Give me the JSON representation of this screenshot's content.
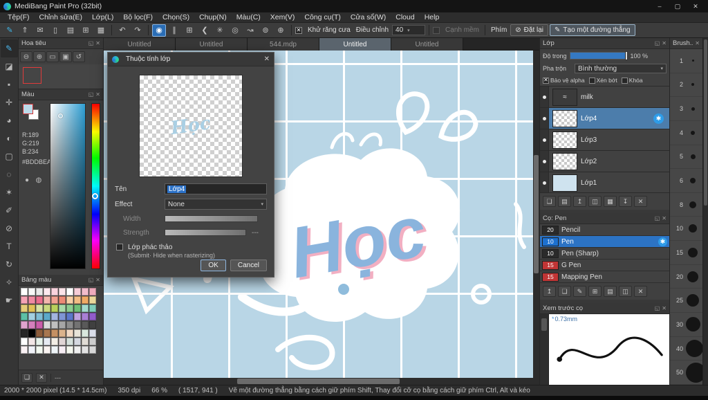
{
  "window": {
    "title": "MediBang Paint Pro (32bit)"
  },
  "icons": {
    "minimize": "–",
    "maximize": "▢",
    "close": "✕",
    "float": "◱",
    "check": "✕",
    "undo": "↶",
    "redo": "↷",
    "dropdown": "▾",
    "reset": "⊘",
    "pen": "✎",
    "star": "*"
  },
  "menu": {
    "items": [
      "Tệp(F)",
      "Chỉnh sửa(E)",
      "Lớp(L)",
      "Bộ lọc(F)",
      "Chọn(S)",
      "Chụp(N)",
      "Màu(C)",
      "Xem(V)",
      "Công cụ(T)",
      "Cửa sổ(W)",
      "Cloud",
      "Help"
    ]
  },
  "toolbar": {
    "file_icons": [
      "✎",
      "⇑",
      "✉",
      "▯",
      "▤",
      "⊞",
      "▦"
    ],
    "option_buttons": [
      {
        "glyph": "◉",
        "selected": true
      },
      {
        "glyph": "∥"
      },
      {
        "glyph": "⊞"
      },
      {
        "glyph": "❮"
      },
      {
        "glyph": "✳"
      },
      {
        "glyph": "◎"
      },
      {
        "glyph": "↝"
      },
      {
        "glyph": "⊚"
      },
      {
        "glyph": "⊕"
      }
    ],
    "antialias_label": "Khử răng cưa",
    "adjust_label": "Điều chỉnh",
    "adjust_value": "40",
    "soft_edge_label": "Cạnh mềm",
    "key_label": "Phím",
    "reset_label": "Đặt lại",
    "line_label": "Tạo một đường thẳng"
  },
  "toolstrip": {
    "tools": [
      "✎",
      "◪",
      "▪",
      "✛",
      "◕",
      "◐",
      "▢",
      "◌",
      "✶",
      "✐",
      "⊘",
      "T",
      "↻",
      "✧",
      "☛"
    ]
  },
  "navigator": {
    "title": "Hoa tiêu",
    "buttons": [
      "⊖",
      "⊕",
      "▭",
      "▣",
      "↺"
    ]
  },
  "color_panel": {
    "title": "Màu",
    "r": "R:189",
    "g": "G:219",
    "b": "B:234",
    "hex": "#BDDBEA",
    "fg_color": "#BDDBEA",
    "circle_icons": [
      "●",
      "◍"
    ]
  },
  "palette_panel": {
    "title": "Bảng màu",
    "footer_value": "---",
    "footer_icons": [
      "❏",
      "✕"
    ],
    "colors": [
      "#ffffff",
      "#f7f7f7",
      "#e8e8e8",
      "#fce8ee",
      "#f9d3de",
      "#fbe3e8",
      "#ffffff",
      "#f6cdd8",
      "#f1bccb",
      "#eeaabc",
      "#f5a3b5",
      "#ef8aa2",
      "#e96f8e",
      "#f3b6ae",
      "#f0a091",
      "#ec8a76",
      "#f7cfa6",
      "#f3bc85",
      "#efa964",
      "#ead79a",
      "#e5cc78",
      "#e0c157",
      "#d9e3a3",
      "#c9d97f",
      "#b9cf5c",
      "#a8d9a8",
      "#8ccc8f",
      "#70bf77",
      "#a3d9cc",
      "#7fccb9",
      "#5cbfa6",
      "#a3cfe0",
      "#7fbcd4",
      "#5ca9c9",
      "#a3b4e0",
      "#7f95d4",
      "#5c77c9",
      "#bfa3e0",
      "#a87fd4",
      "#915cc9",
      "#e0a3cf",
      "#d47fbc",
      "#c95ca9",
      "#d9d9d9",
      "#bfbfbf",
      "#a6a6a6",
      "#8c8c8c",
      "#737373",
      "#595959",
      "#404040",
      "#262626",
      "#000000",
      "#8c5c3b",
      "#a8764f",
      "#c49063",
      "#dbb38c",
      "#f0d9c4",
      "#e8e4d9",
      "#d9e8dd",
      "#d9dde8",
      "#ffffff",
      "#f2e6e6",
      "#e6f2ea",
      "#e6eaf2",
      "#f2eee6",
      "#e0d5d5",
      "#d5e0db",
      "#d5d8e0",
      "#e0dcd5",
      "#cccccc",
      "#f9f1f3",
      "#f1f3f9",
      "#f3f9f1",
      "#f9f3f1",
      "#eef4f7",
      "#f7eef4",
      "#f4f7ee",
      "#efefef",
      "#e3e3e3",
      "#d7d7d7"
    ]
  },
  "tabs": {
    "items": [
      {
        "label": "Untitled"
      },
      {
        "label": "Untitled"
      },
      {
        "label": "544.mdp"
      },
      {
        "label": "Untitled",
        "active": true
      },
      {
        "label": "Untitled"
      }
    ]
  },
  "artwork": {
    "text": "Học"
  },
  "dialog": {
    "title": "Thuộc tính lớp",
    "name_label": "Tên",
    "name_value": "Lớp4",
    "effect_label": "Effect",
    "effect_value": "None",
    "width_label": "Width",
    "strength_label": "Strength",
    "strength_value": "---",
    "draft_label": "Lớp phác thảo",
    "draft_sub": "(Submit· Hide when rasterizing)",
    "ok_label": "OK",
    "cancel_label": "Cancel"
  },
  "layers_panel": {
    "title": "Lớp",
    "opacity_label": "Độ trong",
    "opacity_value": "100 %",
    "blend_label": "Pha trộn",
    "blend_value": "Bình thường",
    "alpha_label": "Bảo vệ alpha",
    "clip_label": "Xén bớt",
    "lock_label": "Khóa",
    "layers": [
      {
        "name": "milk",
        "thumb_bg": "#3b3b3b",
        "thumb_glyph": "≈"
      },
      {
        "name": "Lớp4",
        "selected": true
      },
      {
        "name": "Lớp3"
      },
      {
        "name": "Lớp2"
      },
      {
        "name": "Lớp1",
        "thumb_bg": "#cfe3ef"
      }
    ],
    "footer_icons": [
      "❏",
      "▤",
      "↥",
      "◫",
      "▦",
      "↧",
      "✕"
    ]
  },
  "brush_panel": {
    "title": "Cọ: Pen",
    "brushes": [
      {
        "size": "20",
        "name": "Pencil",
        "chip": "#2a2a2a"
      },
      {
        "size": "10",
        "name": "Pen",
        "chip": "#1c70cf",
        "selected": true
      },
      {
        "size": "10",
        "name": "Pen (Sharp)",
        "chip": "#2a2a2a"
      },
      {
        "size": "15",
        "name": "G Pen",
        "chip": "#c03535"
      },
      {
        "size": "15",
        "name": "Mapping Pen",
        "chip": "#c03535"
      }
    ],
    "footer_icons": [
      "↥",
      "❏",
      "✎",
      "⊞",
      "▤",
      "◫",
      "✕"
    ]
  },
  "preview_panel": {
    "title": "Xem trước cọ",
    "size_value": "0.73mm"
  },
  "brush_sizes": {
    "title": "Brush...",
    "items": [
      {
        "n": "1",
        "d": "3px"
      },
      {
        "n": "2",
        "d": "4px"
      },
      {
        "n": "3",
        "d": "5px"
      },
      {
        "n": "4",
        "d": "6px"
      },
      {
        "n": "5",
        "d": "7px"
      },
      {
        "n": "6",
        "d": "8px"
      },
      {
        "n": "8",
        "d": "10px"
      },
      {
        "n": "10",
        "d": "12px"
      },
      {
        "n": "15",
        "d": "14px"
      },
      {
        "n": "20",
        "d": "16px"
      },
      {
        "n": "25",
        "d": "18px"
      },
      {
        "n": "30",
        "d": "21px"
      },
      {
        "n": "40",
        "d": "25px"
      },
      {
        "n": "50",
        "d": "29px"
      }
    ]
  },
  "status": {
    "dimensions": "2000 * 2000 pixel  (14.5 * 14.5cm)",
    "dpi": "350 dpi",
    "zoom": "66 %",
    "coords": "( 1517, 941 )",
    "hint": "Vẽ một đường thẳng bằng cách giữ phím Shift, Thay đổi cỡ cọ bằng cách giữ phím Ctrl, Alt và kéo"
  }
}
